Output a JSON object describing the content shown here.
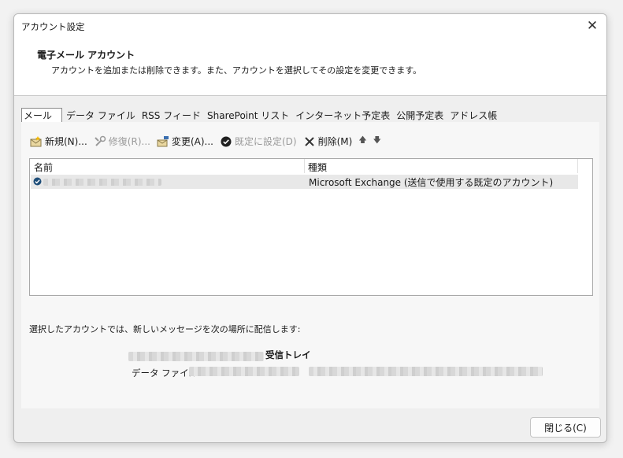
{
  "window": {
    "title": "アカウント設定",
    "close_glyph": "✕"
  },
  "header": {
    "title": "電子メール アカウント",
    "description": "アカウントを追加または削除できます。また、アカウントを選択してその設定を変更できます。"
  },
  "tabs": [
    {
      "label": "メール",
      "active": true
    },
    {
      "label": "データ ファイル",
      "active": false
    },
    {
      "label": "RSS フィード",
      "active": false
    },
    {
      "label": "SharePoint リスト",
      "active": false
    },
    {
      "label": "インターネット予定表",
      "active": false
    },
    {
      "label": "公開予定表",
      "active": false
    },
    {
      "label": "アドレス帳",
      "active": false
    }
  ],
  "toolbar": {
    "new_label": "新規(N)...",
    "repair_label": "修復(R)...",
    "change_label": "変更(A)...",
    "default_label": "既定に設定(D)",
    "delete_label": "削除(M)",
    "up_glyph": "🡅",
    "down_glyph": "🡇",
    "icons": [
      "new-account-icon",
      "repair-icon",
      "change-icon",
      "check-circle-icon",
      "delete-x-icon",
      "arrow-up-icon",
      "arrow-down-icon"
    ]
  },
  "account_list": {
    "columns": [
      "名前",
      "種類"
    ],
    "rows": [
      {
        "name": "",
        "type": "Microsoft Exchange (送信で使用する既定のアカウント)",
        "selected": true
      }
    ]
  },
  "delivery": {
    "label": "選択したアカウントでは、新しいメッセージを次の場所に配信します:",
    "folder": "受信トレイ",
    "data_file_label": "データ ファイル:"
  },
  "footer": {
    "close_label": "閉じる(C)"
  },
  "colors": {
    "accent_check": "#1f4e79",
    "window_bg": "#efefef",
    "panel_bg": "#f7f7f7"
  }
}
